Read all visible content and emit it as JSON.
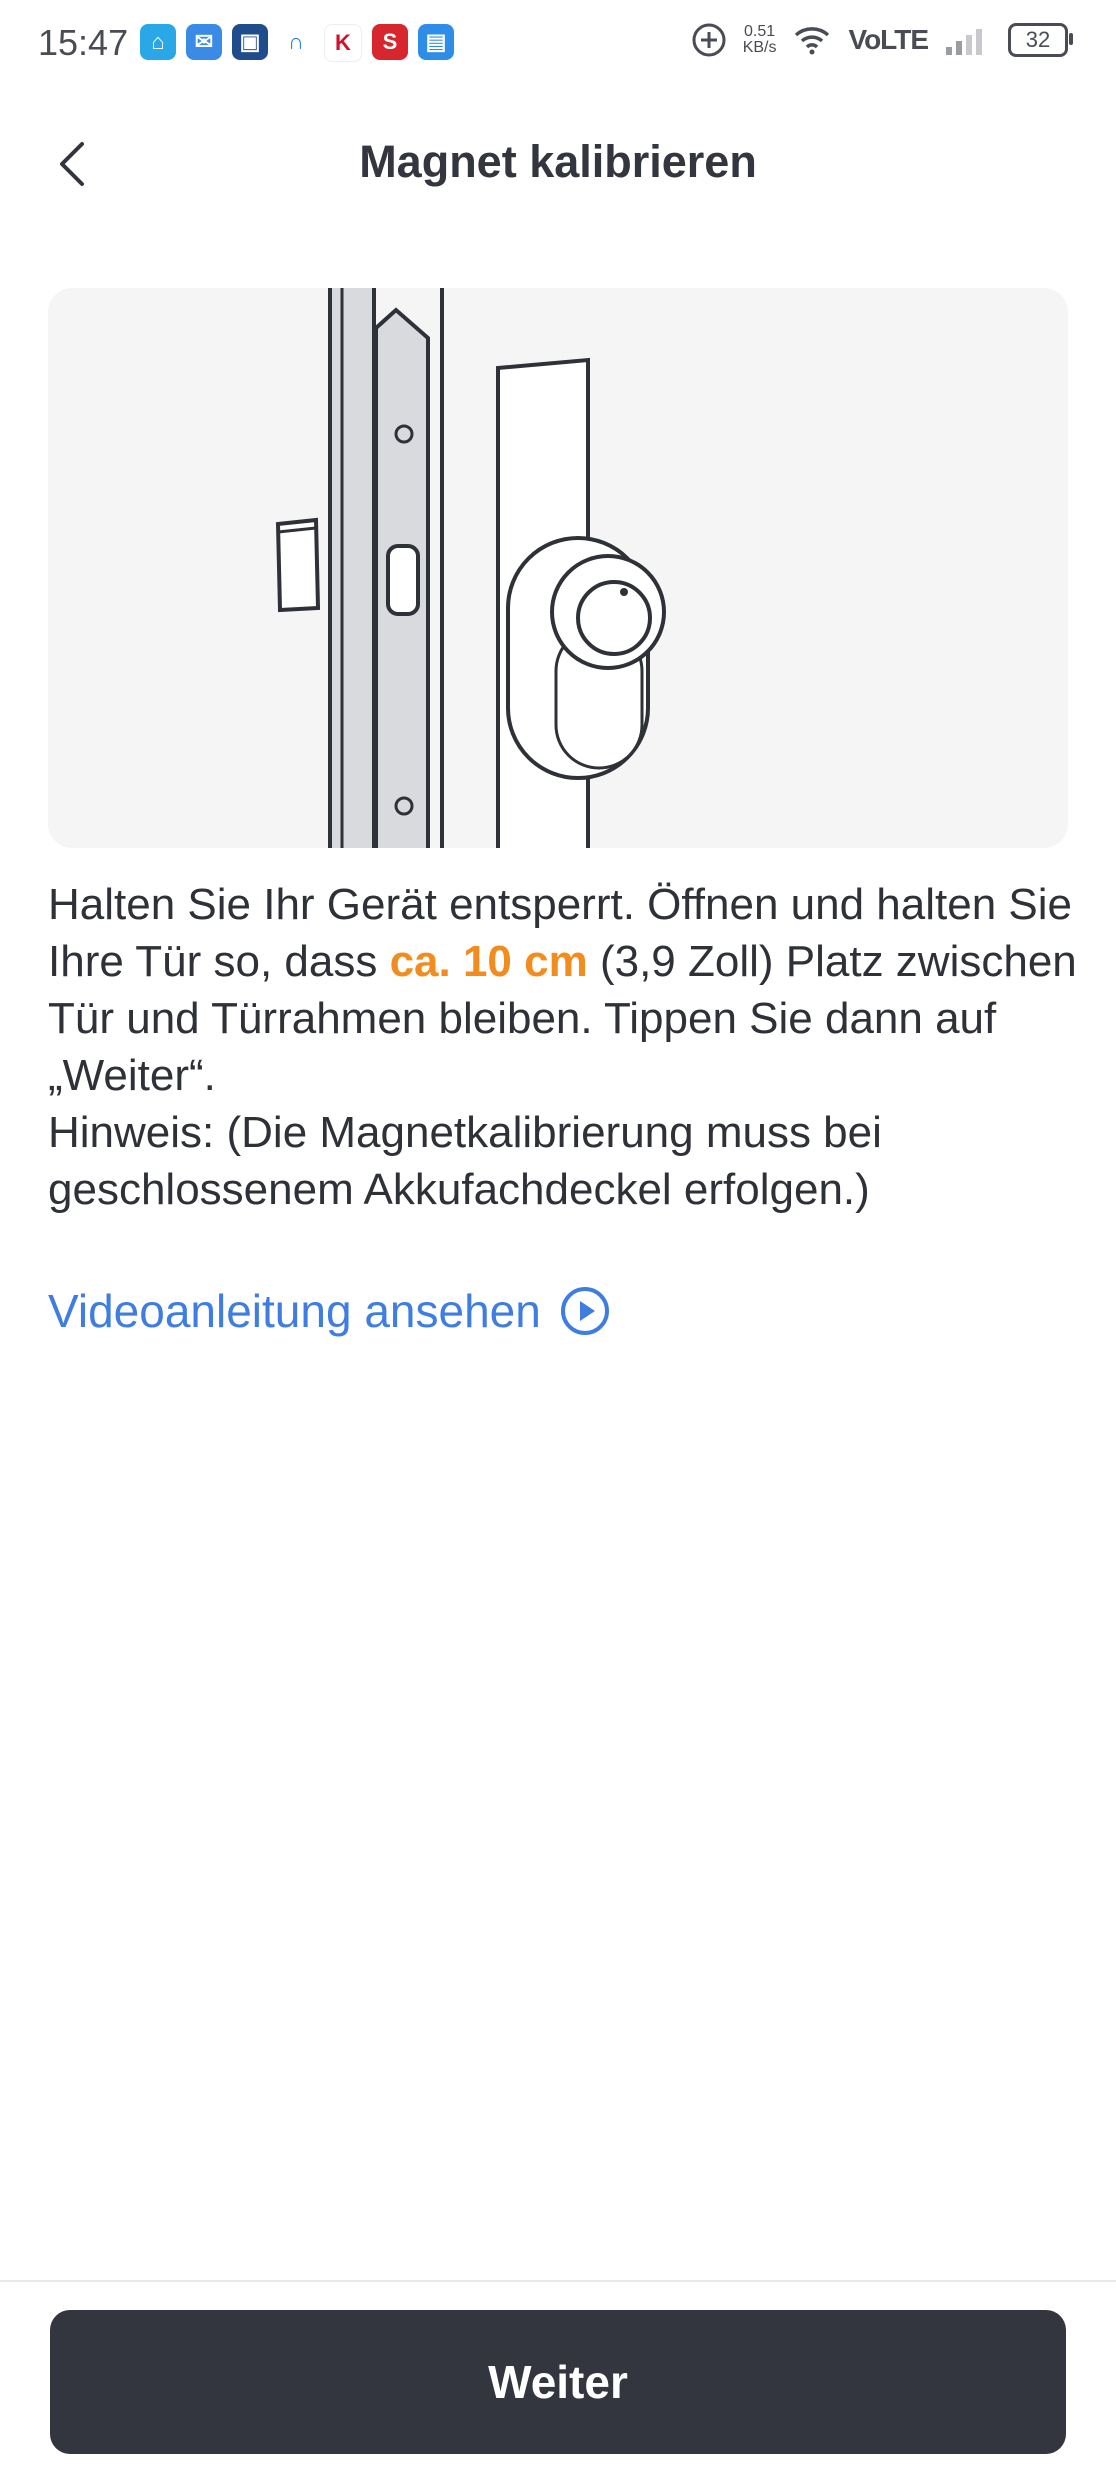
{
  "status": {
    "time": "15:47",
    "speed_value": "0.51",
    "speed_unit": "KB/s",
    "network": "VoLTE",
    "battery": "32"
  },
  "header": {
    "title": "Magnet kalibrieren"
  },
  "instructions": {
    "part1": "Halten Sie Ihr Gerät entsperrt. Öffnen und halten Sie Ihre Tür so, dass ",
    "highlight": "ca. 10 cm",
    "part2": " (3,9 Zoll) Platz zwischen Tür und Türrahmen bleiben. Tippen Sie dann auf „Weiter“.",
    "note": "Hinweis: (Die Magnetkalibrierung muss bei geschlossenem Akkufachdeckel erfolgen.)"
  },
  "video_link": {
    "label": "Videoanleitung ansehen"
  },
  "footer": {
    "next_label": "Weiter"
  },
  "colors": {
    "highlight": "#f28c1e",
    "link": "#3f7ee0",
    "button": "#33353f"
  }
}
